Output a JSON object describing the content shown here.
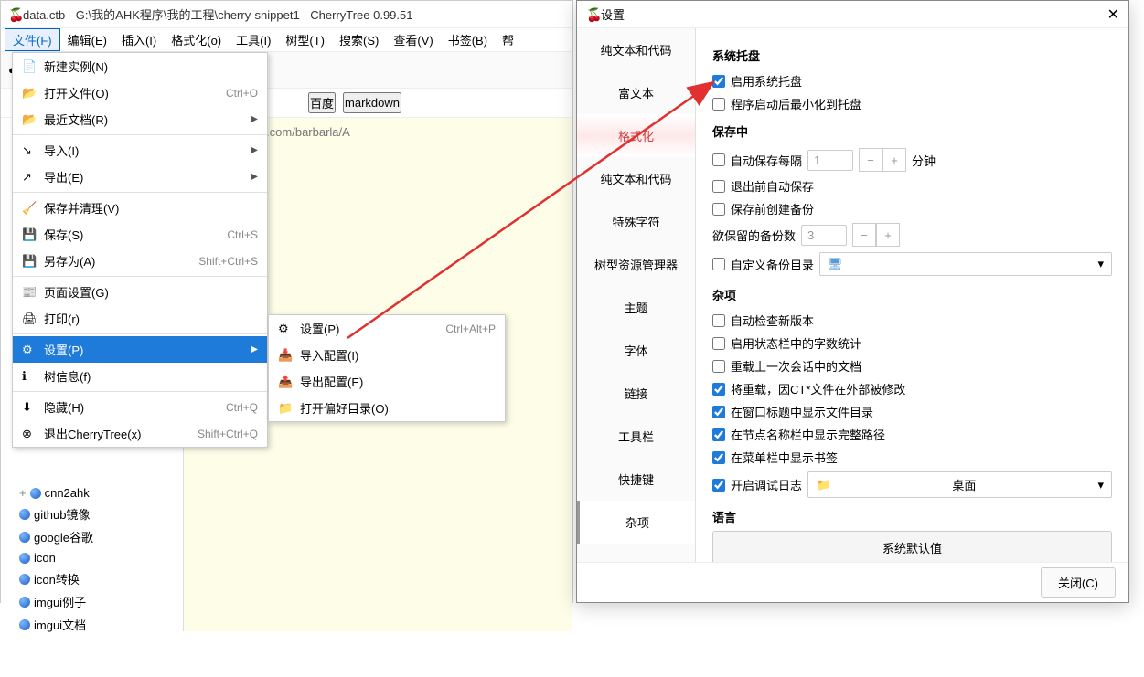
{
  "window": {
    "title": "data.ctb - G:\\我的AHK程序\\我的工程\\cherry-snippet1 - CherryTree 0.99.51"
  },
  "menubar": [
    "文件(F)",
    "编辑(E)",
    "插入(I)",
    "格式化(o)",
    "工具(I)",
    "树型(T)",
    "搜索(S)",
    "查看(V)",
    "书签(B)",
    "帮"
  ],
  "toolbar": {
    "btn_baidu": "百度",
    "btn_markdown": "markdown"
  },
  "editor": {
    "line1": "n,https://gitee.com/barbarla/A"
  },
  "tree_items": [
    "cnn2ahk",
    "github镜像",
    "google谷歌",
    "icon",
    "icon转换",
    "imgui例子",
    "imgui文档"
  ],
  "file_menu": {
    "items": [
      {
        "label": "新建实例(N)",
        "shortcut": "",
        "icon": "new"
      },
      {
        "label": "打开文件(O)",
        "shortcut": "Ctrl+O",
        "icon": "open"
      },
      {
        "label": "最近文档(R)",
        "shortcut": "",
        "icon": "recent",
        "submenu": true
      },
      {
        "label": "导入(I)",
        "shortcut": "",
        "icon": "import",
        "submenu": true
      },
      {
        "label": "导出(E)",
        "shortcut": "",
        "icon": "export",
        "submenu": true
      },
      {
        "label": "保存并清理(V)",
        "shortcut": "",
        "icon": "vacuum"
      },
      {
        "label": "保存(S)",
        "shortcut": "Ctrl+S",
        "icon": "save"
      },
      {
        "label": "另存为(A)",
        "shortcut": "Shift+Ctrl+S",
        "icon": "saveas"
      },
      {
        "label": "页面设置(G)",
        "shortcut": "",
        "icon": "page"
      },
      {
        "label": "打印(r)",
        "shortcut": "",
        "icon": "print"
      },
      {
        "label": "设置(P)",
        "shortcut": "",
        "icon": "prefs",
        "submenu": true,
        "highlighted": true
      },
      {
        "label": "树信息(f)",
        "shortcut": "",
        "icon": "info"
      },
      {
        "label": "隐藏(H)",
        "shortcut": "Ctrl+Q",
        "icon": "hide"
      },
      {
        "label": "退出CherryTree(x)",
        "shortcut": "Shift+Ctrl+Q",
        "icon": "quit"
      }
    ]
  },
  "submenu_settings": {
    "items": [
      {
        "label": "设置(P)",
        "shortcut": "Ctrl+Alt+P"
      },
      {
        "label": "导入配置(I)",
        "shortcut": ""
      },
      {
        "label": "导出配置(E)",
        "shortcut": ""
      },
      {
        "label": "打开偏好目录(O)",
        "shortcut": ""
      }
    ]
  },
  "settings": {
    "title": "设置",
    "nav": [
      "纯文本和代码",
      "富文本",
      "格式化",
      "纯文本和代码",
      "特殊字符",
      "树型资源管理器",
      "主题",
      "字体",
      "链接",
      "工具栏",
      "快捷键",
      "杂项"
    ],
    "section_tray": "系统托盘",
    "cb_enable_tray": "启用系统托盘",
    "cb_min_to_tray": "程序启动后最小化到托盘",
    "section_saving": "保存中",
    "cb_autosave": "自动保存每隔",
    "autosave_val": "1",
    "autosave_unit": "分钟",
    "cb_save_on_quit": "退出前自动保存",
    "cb_backup_before_save": "保存前创建备份",
    "label_backup_count": "欲保留的备份数",
    "backup_count_val": "3",
    "cb_custom_backup_dir": "自定义备份目录",
    "section_misc": "杂项",
    "cb_check_update": "自动检查新版本",
    "cb_word_count": "启用状态栏中的字数统计",
    "cb_reload_session": "重载上一次会话中的文档",
    "cb_reload_modified": "将重载，因CT*文件在外部被修改",
    "cb_show_path_title": "在窗口标题中显示文件目录",
    "cb_show_full_path": "在节点名称栏中显示完整路径",
    "cb_show_bookmarks": "在菜单栏中显示书签",
    "cb_debug_log": "开启调试日志",
    "debug_log_dir": "桌面",
    "section_lang": "语言",
    "btn_sys_default": "系统默认值",
    "btn_close": "关闭(C)"
  }
}
